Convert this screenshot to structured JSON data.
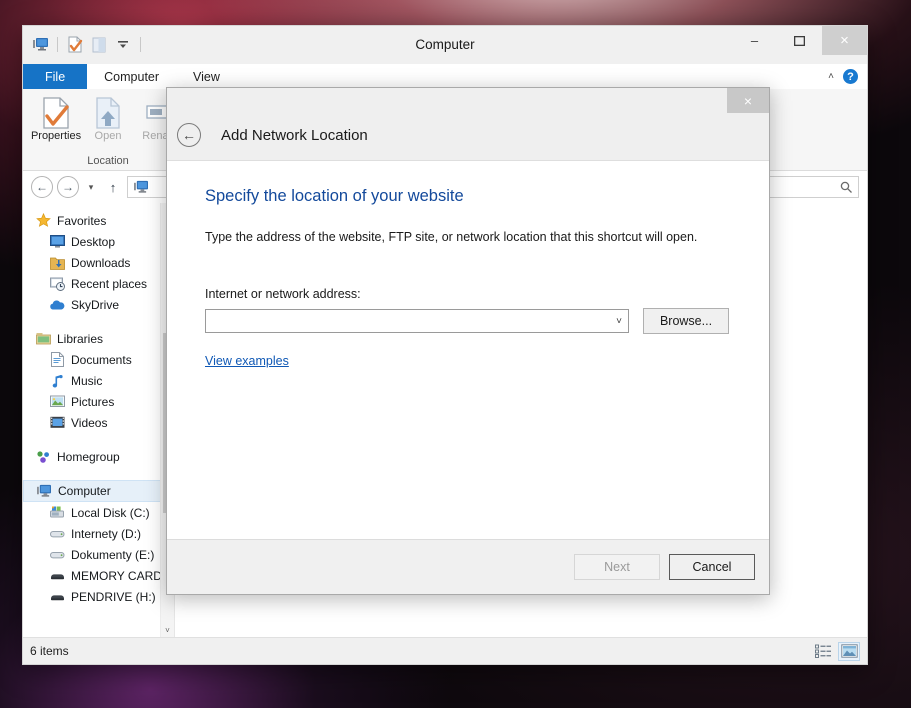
{
  "window": {
    "title": "Computer",
    "quick_access": [
      {
        "name": "computer-icon",
        "label": "Computer"
      },
      {
        "name": "properties-icon",
        "label": "Properties"
      },
      {
        "name": "open-icon",
        "label": "Open"
      },
      {
        "name": "customize-dropdown-icon",
        "label": "Customize Quick Access Toolbar"
      }
    ],
    "controls": {
      "minimize": "–",
      "maximize": "❐",
      "close": "×"
    }
  },
  "ribbon": {
    "tabs": [
      {
        "label": "File",
        "type": "file"
      },
      {
        "label": "Computer",
        "type": "active"
      },
      {
        "label": "View",
        "type": "normal"
      }
    ],
    "collapse_chevron": "˄",
    "help_glyph": "?",
    "groups": [
      {
        "label": "Location",
        "buttons": [
          {
            "label": "Properties",
            "icon": "properties-icon",
            "enabled": true
          },
          {
            "label": "Open",
            "icon": "open-icon",
            "enabled": false
          },
          {
            "label": "Renam",
            "icon": "rename-icon",
            "enabled": false
          }
        ]
      }
    ]
  },
  "addressbar": {
    "back": "←",
    "forward": "→",
    "history_caret": "▾",
    "up": "↑",
    "path_label": "",
    "search_placeholder": "",
    "search_icon": "search-icon"
  },
  "sidebar": {
    "groups": [
      {
        "header": {
          "label": "Favorites",
          "icon": "star-icon"
        },
        "items": [
          {
            "label": "Desktop",
            "icon": "desktop-icon"
          },
          {
            "label": "Downloads",
            "icon": "downloads-icon"
          },
          {
            "label": "Recent places",
            "icon": "recent-places-icon"
          },
          {
            "label": "SkyDrive",
            "icon": "skydrive-icon"
          }
        ]
      },
      {
        "header": {
          "label": "Libraries",
          "icon": "libraries-icon"
        },
        "items": [
          {
            "label": "Documents",
            "icon": "documents-icon"
          },
          {
            "label": "Music",
            "icon": "music-icon"
          },
          {
            "label": "Pictures",
            "icon": "pictures-icon"
          },
          {
            "label": "Videos",
            "icon": "videos-icon"
          }
        ]
      },
      {
        "header": {
          "label": "Homegroup",
          "icon": "homegroup-icon"
        },
        "items": []
      },
      {
        "header": {
          "label": "Computer",
          "icon": "computer-icon",
          "selected": true
        },
        "items": [
          {
            "label": "Local Disk (C:)",
            "icon": "system-drive-icon"
          },
          {
            "label": "Internety (D:)",
            "icon": "drive-icon"
          },
          {
            "label": "Dokumenty (E:)",
            "icon": "drive-icon"
          },
          {
            "label": "MEMORY CARD",
            "icon": "removable-drive-icon"
          },
          {
            "label": "PENDRIVE (H:)",
            "icon": "removable-drive-icon"
          }
        ]
      }
    ],
    "scroll_down_arrow": "˅"
  },
  "statusbar": {
    "item_count": "6 items",
    "views": [
      {
        "name": "details-view-button",
        "active": false
      },
      {
        "name": "large-icons-view-button",
        "active": true
      }
    ]
  },
  "dialog": {
    "title": "Add Network Location",
    "back_glyph": "←",
    "close_glyph": "×",
    "heading": "Specify the location of your website",
    "description": "Type the address of the website, FTP site, or network location that this shortcut will open.",
    "field": {
      "label": "Internet or network address:",
      "value": "",
      "placeholder": "",
      "caret": "˅"
    },
    "browse_button": "Browse...",
    "examples_link": "View examples",
    "buttons": {
      "next": "Next",
      "next_enabled": false,
      "cancel": "Cancel",
      "cancel_focused": true
    }
  },
  "colors": {
    "file_tab": "#1673c6",
    "dialog_heading": "#13499b",
    "link": "#0f58b5",
    "selection": "#e6f0f9"
  }
}
